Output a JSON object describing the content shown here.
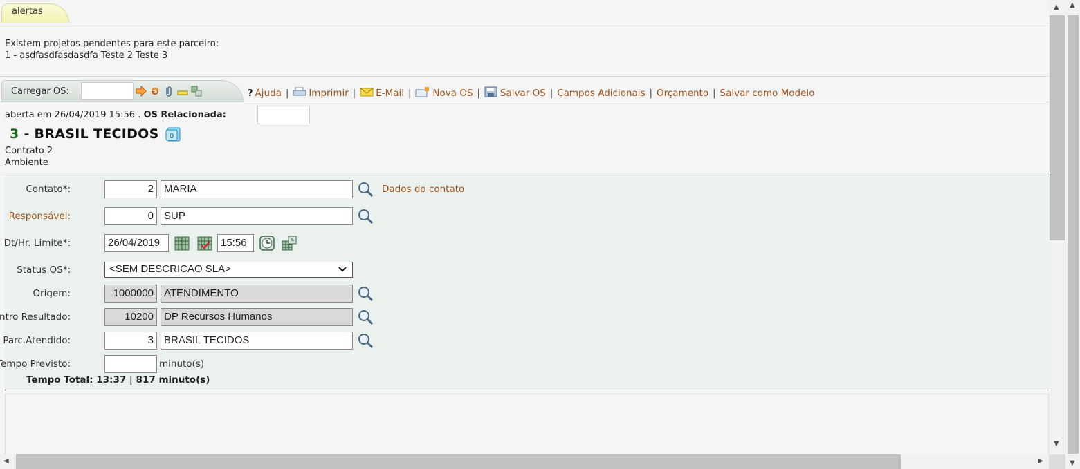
{
  "alerts": {
    "tab_label": "alertas",
    "line1": "Existem projetos pendentes para este parceiro:",
    "line2": "1 - asdfasdfasdasdfa Teste 2 Teste 3"
  },
  "toolbar": {
    "load_label": "Carregar OS:",
    "load_value": "",
    "icons": [
      "arrow-right-icon",
      "refresh-icon",
      "clip-icon",
      "key-icon",
      "link-icon"
    ],
    "menu": [
      {
        "label": "Ajuda",
        "icon": "help-icon"
      },
      {
        "label": "Imprimir",
        "icon": "printer-icon"
      },
      {
        "label": "E-Mail",
        "icon": "mail-icon"
      },
      {
        "label": "Nova OS",
        "icon": "new-os-icon"
      },
      {
        "label": "Salvar OS",
        "icon": "save-icon"
      },
      {
        "label": "Campos Adicionais",
        "icon": ""
      },
      {
        "label": "Orçamento",
        "icon": ""
      },
      {
        "label": "Salvar como Modelo",
        "icon": ""
      }
    ],
    "separator": "|"
  },
  "header": {
    "opened_text": "aberta em 26/04/2019 15:56 .",
    "related_label": "OS Relacionada:",
    "related_value": "",
    "number": "3",
    "title": "- BRASIL TECIDOS",
    "doc_badge": "0",
    "contract": "Contrato 2",
    "environment": "Ambiente"
  },
  "form": {
    "contato": {
      "label": "Contato*:",
      "code": "2",
      "name": "MARIA",
      "link": "Dados do contato"
    },
    "responsavel": {
      "label": "Responsável:",
      "code": "0",
      "name": "SUP"
    },
    "limite": {
      "label": "Dt/Hr. Limite*:",
      "date": "26/04/2019",
      "time": "15:56"
    },
    "status": {
      "label": "Status OS*:",
      "selected": "<SEM DESCRICAO SLA>"
    },
    "origem": {
      "label": "Origem:",
      "code": "1000000",
      "name": "ATENDIMENTO"
    },
    "centro": {
      "label": "Centro Resultado:",
      "code": "10200",
      "name": "DP Recursos Humanos"
    },
    "parceiro": {
      "label": "Parc.Atendido:",
      "code": "3",
      "name": "BRASIL TECIDOS"
    },
    "tempo_previsto": {
      "label": "Tempo Previsto:",
      "value": "",
      "unit": "minuto(s)"
    },
    "tempo_total": "Tempo Total: 13:37 | 817 minuto(s)"
  },
  "colors": {
    "link": "#a0521b",
    "form_bg": "#ebf1ed",
    "alert_tab": "#f3f3b4",
    "number_green": "#1a6b1a"
  }
}
